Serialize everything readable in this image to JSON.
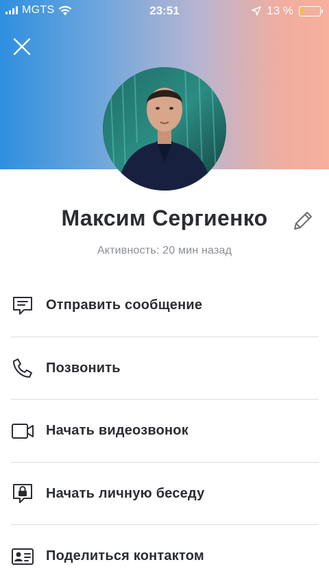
{
  "status_bar": {
    "carrier": "MGTS",
    "time": "23:51",
    "battery_percent": "13 %",
    "battery_level": 0.13
  },
  "profile": {
    "name": "Максим Сергиенко",
    "activity": "Активность: 20 мин назад"
  },
  "actions": [
    {
      "label": "Отправить сообщение",
      "icon": "message-icon"
    },
    {
      "label": "Позвонить",
      "icon": "phone-icon"
    },
    {
      "label": "Начать видеозвонок",
      "icon": "video-camera-icon"
    },
    {
      "label": "Начать личную беседу",
      "icon": "lock-chat-icon"
    },
    {
      "label": "Поделиться контактом",
      "icon": "contact-card-icon"
    }
  ],
  "colors": {
    "gradient_start": "#2f8fe0",
    "gradient_end": "#f6b09c",
    "text_primary": "#2b2d31",
    "text_secondary": "#8a8d92"
  }
}
